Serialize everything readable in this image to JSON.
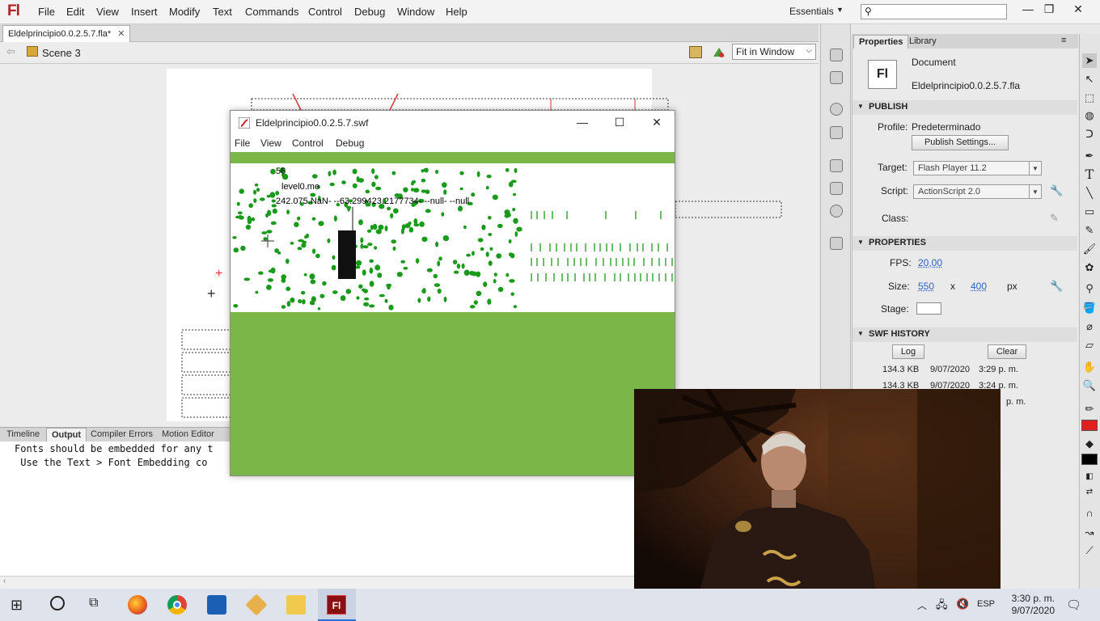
{
  "app": {
    "logo": "Fl",
    "menu": [
      "File",
      "Edit",
      "View",
      "Insert",
      "Modify",
      "Text",
      "Commands",
      "Control",
      "Debug",
      "Window",
      "Help"
    ],
    "workspace": "Essentials",
    "search_placeholder": ""
  },
  "document": {
    "tab_title": "Eldelprincipio0.0.2.5.7.fla*",
    "scene": "Scene 3",
    "zoom": "Fit in Window"
  },
  "properties": {
    "tabs": [
      "Properties",
      "Library"
    ],
    "doc_type": "Document",
    "doc_icon_text": "Fl",
    "file_name": "Eldelprincipio0.0.2.5.7.fla",
    "publish_header": "PUBLISH",
    "profile_label": "Profile:",
    "profile_value": "Predeterminado",
    "publish_settings_btn": "Publish Settings...",
    "target_label": "Target:",
    "target_value": "Flash Player 11.2",
    "script_label": "Script:",
    "script_value": "ActionScript 2.0",
    "class_label": "Class:",
    "props_header": "PROPERTIES",
    "fps_label": "FPS:",
    "fps_value": "20,00",
    "size_label": "Size:",
    "width": "550",
    "x_sep": "x",
    "height": "400",
    "unit": "px",
    "stage_label": "Stage:",
    "stage_color": "#ffffff",
    "swf_history_header": "SWF HISTORY",
    "log_btn": "Log",
    "clear_btn": "Clear",
    "history": [
      {
        "size": "134.3 KB",
        "date": "9/07/2020",
        "time": "3:29 p. m."
      },
      {
        "size": "134.3 KB",
        "date": "9/07/2020",
        "time": "3:24 p. m."
      },
      {
        "size": "",
        "date": "",
        "time": "p. m."
      }
    ]
  },
  "bottom_panel": {
    "tabs": [
      "Timeline",
      "Output",
      "Compiler Errors",
      "Motion Editor"
    ],
    "output_lines": [
      "Fonts should be embedded for any t",
      " Use the Text > Font Embedding co"
    ]
  },
  "swf_window": {
    "title": "Eldelprincipio0.0.2.5.7.swf",
    "menu": [
      "File",
      "View",
      "Control",
      "Debug"
    ],
    "debug_line1": "56",
    "debug_line2": "level0.me",
    "debug_line3": "242.075.NaN- --63.299423.2177734- --null- --null"
  },
  "taskbar": {
    "lang": "ESP",
    "time": "3:30 p. m.",
    "date": "9/07/2020"
  },
  "colors": {
    "swf_green": "#7ab648",
    "dot_green": "#1a9a1a",
    "fl_red": "#b52020"
  }
}
